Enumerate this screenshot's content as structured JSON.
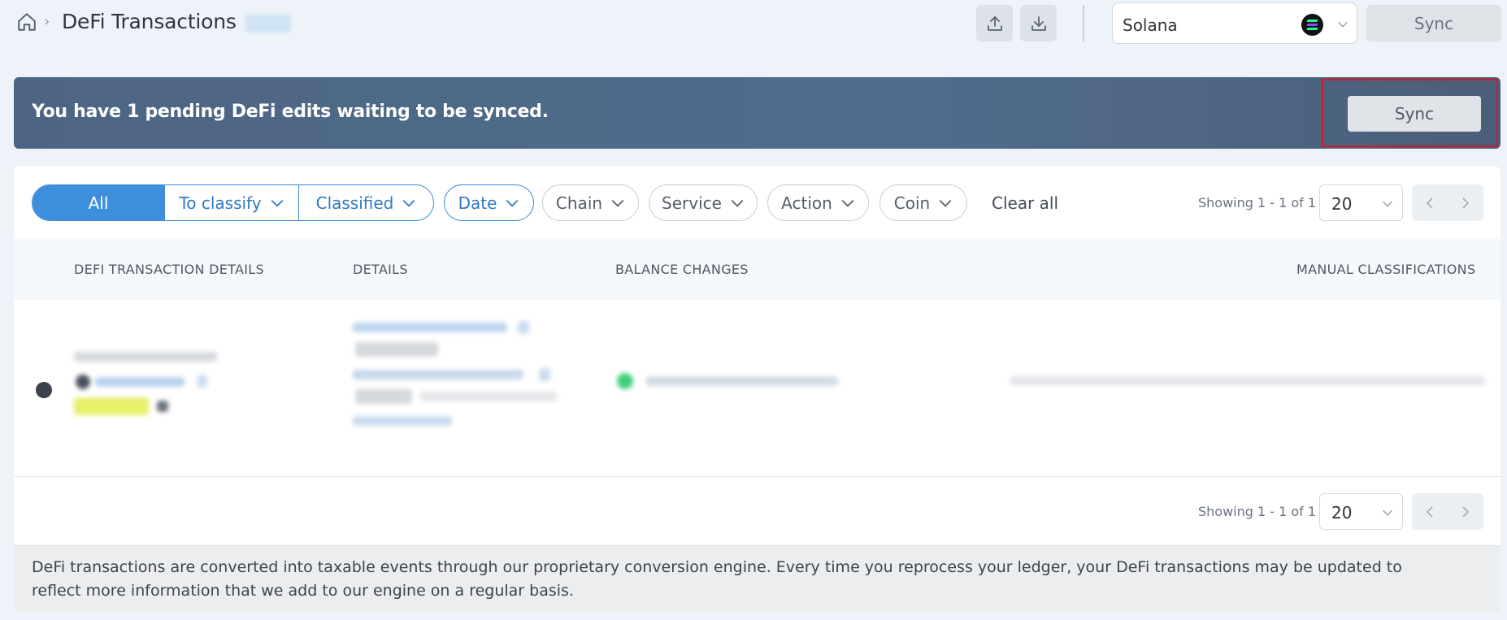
{
  "header": {
    "breadcrumb_separator": "›",
    "title": "DeFi Transactions",
    "chain_select": {
      "value": "Solana"
    },
    "sync_label": "Sync"
  },
  "banner": {
    "message": "You have 1 pending DeFi edits waiting to be synced.",
    "sync_label": "Sync"
  },
  "filters": {
    "segments": [
      {
        "label": "All",
        "active": true
      },
      {
        "label": "To classify",
        "active": false
      },
      {
        "label": "Classified",
        "active": false
      }
    ],
    "pills": [
      {
        "label": "Date"
      },
      {
        "label": "Chain"
      },
      {
        "label": "Service"
      },
      {
        "label": "Action"
      },
      {
        "label": "Coin"
      }
    ],
    "clear_all": "Clear all"
  },
  "pagination": {
    "showing": "Showing 1 - 1 of 1",
    "per_page": "20"
  },
  "table": {
    "columns": [
      "DEFI TRANSACTION DETAILS",
      "DETAILS",
      "BALANCE CHANGES",
      "MANUAL CLASSIFICATIONS"
    ]
  },
  "footer": {
    "note": "DeFi transactions are converted into taxable events through our proprietary conversion engine. Every time you reprocess your ledger, your DeFi transactions may be updated to reflect more information that we add to our engine on a regular basis."
  },
  "colors": {
    "accent": "#3d8fdc",
    "banner": "#506c8c",
    "highlight_border": "#d0182a"
  },
  "icons": [
    "home-icon",
    "upload-icon",
    "download-icon",
    "solana-logo-icon",
    "chevron-down-icon",
    "chevron-left-icon",
    "chevron-right-icon",
    "external-link-icon"
  ]
}
